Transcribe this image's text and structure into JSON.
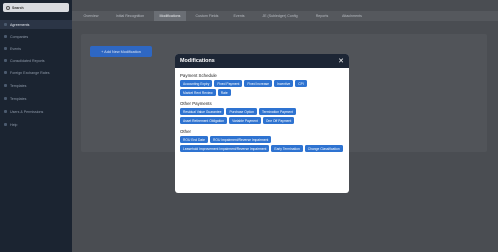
{
  "sidebar": {
    "search_label": "Search",
    "items": [
      {
        "label": "Agreements",
        "active": true
      },
      {
        "label": "Companies"
      },
      {
        "label": "Events"
      },
      {
        "label": "Consolidated Reports"
      },
      {
        "label": "Foreign Exchange Rates"
      },
      {
        "label": "Templates"
      },
      {
        "label": "Templates"
      },
      {
        "label": "Users & Permissions"
      },
      {
        "label": "Help"
      }
    ]
  },
  "tabs": [
    {
      "label": "Overview"
    },
    {
      "label": "Initial Recognition"
    },
    {
      "label": "Modifications",
      "active": true
    },
    {
      "label": "Custom Fields"
    },
    {
      "label": "Events"
    },
    {
      "label": "JE (Subledger) Config"
    },
    {
      "label": "Reports"
    },
    {
      "label": "Attachments"
    }
  ],
  "main": {
    "add_button_label": "+ Add New Modification"
  },
  "modal": {
    "title": "Modifications",
    "close_glyph": "✕",
    "sections": [
      {
        "title": "Payment Schedule",
        "options": [
          "Accounting Expiry",
          "Fixed Payment",
          "Fixed Increase",
          "Incentive",
          "CPI",
          "Market Rent Review",
          "Rate"
        ]
      },
      {
        "title": "Other Payments",
        "options": [
          "Residual Value Guarantee",
          "Purchase Option",
          "Termination Payment",
          "Asset Retirement Obligation",
          "Variable Payment",
          "One Off Payment"
        ]
      },
      {
        "title": "Other",
        "options": [
          "ROU End Date",
          "ROU Impairment/Reverse Impairment",
          "Leasehold Improvement Impairment/Reverse Impairment",
          "Early Termination",
          "Change Classification"
        ]
      }
    ]
  },
  "colors": {
    "sidebar_bg": "#1b2431",
    "modal_header_bg": "#1d2635",
    "chip_bg": "#2e73d1",
    "add_button_bg": "#2e67c3"
  }
}
